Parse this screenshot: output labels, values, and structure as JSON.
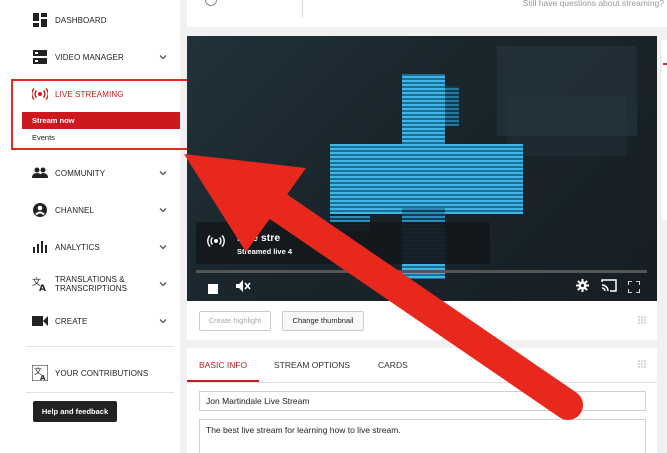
{
  "sidebar": {
    "items": [
      {
        "label": "DASHBOARD",
        "icon": "dashboard-icon"
      },
      {
        "label": "VIDEO MANAGER",
        "icon": "video-manager-icon"
      },
      {
        "label": "LIVE STREAMING",
        "icon": "live-broadcast-icon"
      },
      {
        "label": "COMMUNITY",
        "icon": "people-icon"
      },
      {
        "label": "CHANNEL",
        "icon": "person-icon"
      },
      {
        "label": "ANALYTICS",
        "icon": "bar-chart-icon"
      },
      {
        "label": "TRANSLATIONS & TRANSCRIPTIONS",
        "icon": "translate-icon"
      },
      {
        "label": "CREATE",
        "icon": "video-camera-icon"
      },
      {
        "label": "YOUR CONTRIBUTIONS",
        "icon": "translate-icon"
      }
    ],
    "sub_items": {
      "stream_now": "Stream now",
      "events": "Events"
    },
    "help_button": "Help and feedback",
    "accent_color": "#cc181e",
    "highlight_color": "#e8281c"
  },
  "top": {
    "questions": "Still have questions about streaming?"
  },
  "video": {
    "overlay_title": "Live stre",
    "overlay_subtitle": "Streamed live 4"
  },
  "actions": {
    "create_highlight": "Create highlight",
    "change_thumbnail": "Change thumbnail"
  },
  "tabs": [
    {
      "label": "BASIC INFO",
      "active": true
    },
    {
      "label": "STREAM OPTIONS",
      "active": false
    },
    {
      "label": "CARDS",
      "active": false
    }
  ],
  "form": {
    "title_value": "Jon Martindale Live Stream",
    "description_value": "The best live stream for learning how to live stream."
  }
}
